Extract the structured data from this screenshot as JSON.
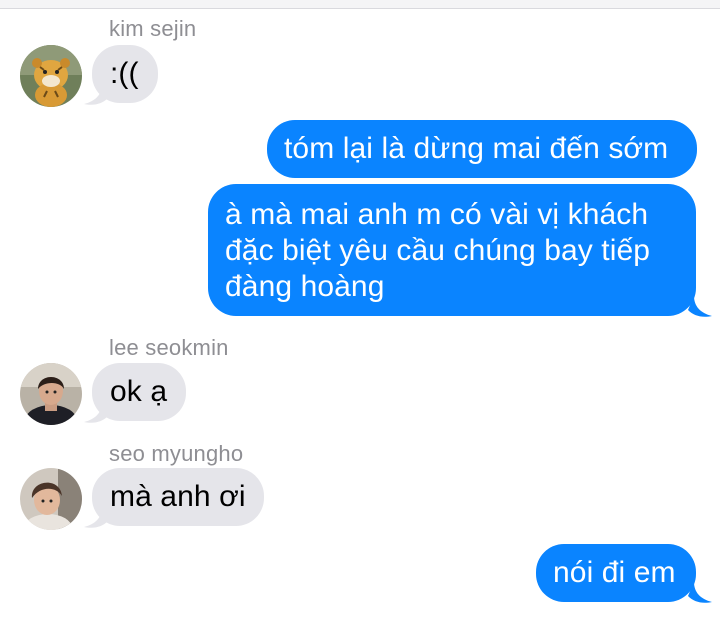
{
  "thread": {
    "messages": [
      {
        "sender": "kim sejin",
        "text": ":((",
        "direction": "incoming",
        "avatar": "tiger-plush-avatar"
      },
      {
        "text": "tóm lại là dừng mai đến sớm",
        "direction": "outgoing"
      },
      {
        "text": "à mà mai anh m có vài vị khách\nđặc biệt yêu cầu chúng bay tiếp\nđàng hoàng",
        "direction": "outgoing"
      },
      {
        "sender": "lee seokmin",
        "text": "ok ạ",
        "direction": "incoming",
        "avatar": "person-dark-jacket-avatar"
      },
      {
        "sender": "seo myungho",
        "text": "mà anh ơi",
        "direction": "incoming",
        "avatar": "person-light-hair-avatar"
      },
      {
        "text": "nói đi em",
        "direction": "outgoing"
      }
    ]
  },
  "colors": {
    "incoming_bubble": "#e5e5ea",
    "outgoing_bubble": "#0a84ff",
    "sender_name": "#8e8e93"
  }
}
